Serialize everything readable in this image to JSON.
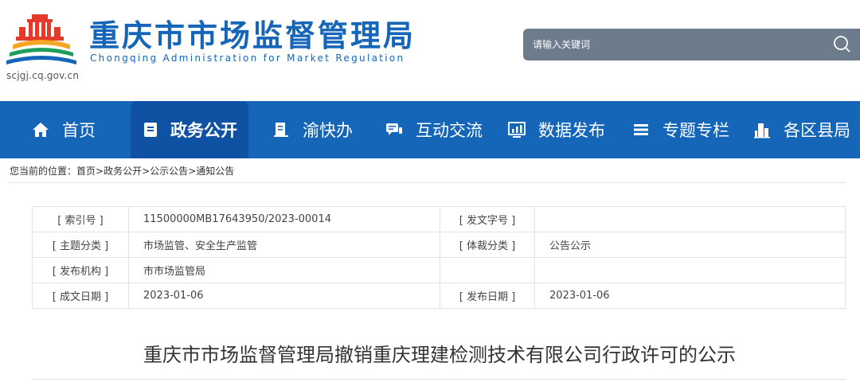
{
  "header": {
    "title": "重庆市市场监督管理局",
    "subtitle": "Chongqing  Administration for Market Regulation",
    "domain": "scjgj.cq.gov.cn",
    "brand_color": "#1565b8"
  },
  "search": {
    "placeholder": "请输入关键词",
    "icon": "search-icon"
  },
  "nav": {
    "items": [
      {
        "label": "首页",
        "icon": "home-icon"
      },
      {
        "label": "政务公开",
        "icon": "document-icon",
        "active": true
      },
      {
        "label": "渝快办",
        "icon": "book-icon"
      },
      {
        "label": "互动交流",
        "icon": "chat-icon"
      },
      {
        "label": "数据发布",
        "icon": "chart-icon"
      },
      {
        "label": "专题专栏",
        "icon": "list-icon"
      },
      {
        "label": "各区县局",
        "icon": "building-icon"
      }
    ]
  },
  "breadcrumb": {
    "prefix": "您当前的位置：",
    "items": [
      "首页",
      "政务公开",
      "公示公告",
      "通知公告"
    ],
    "sep": ">"
  },
  "info": {
    "rows": [
      [
        "[ 索引号 ]",
        "11500000MB17643950/2023-00014",
        "[ 发文字号 ]",
        ""
      ],
      [
        "[ 主题分类 ]",
        "市场监管、安全生产监管",
        "[ 体裁分类 ]",
        "公告公示"
      ],
      [
        "[ 发布机构 ]",
        "市市场监管局",
        "",
        ""
      ],
      [
        "[ 成文日期 ]",
        "2023-01-06",
        "[ 发布日期 ]",
        "2023-01-06"
      ]
    ]
  },
  "doc": {
    "title": "重庆市市场监督管理局撤销重庆理建检测技术有限公司行政许可的公示"
  }
}
